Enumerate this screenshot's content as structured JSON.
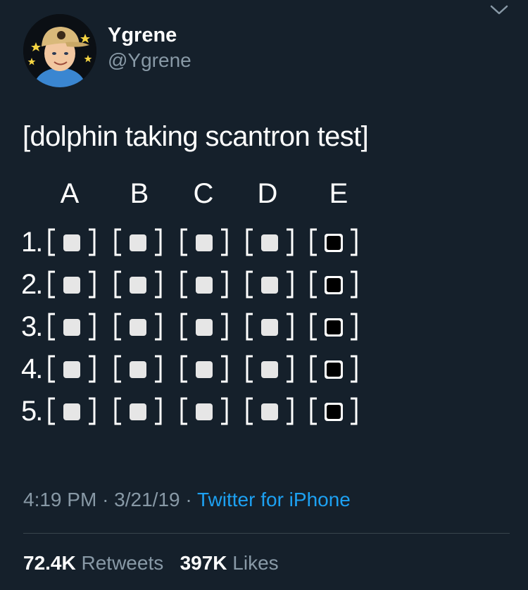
{
  "tweet": {
    "author": {
      "display_name": "Ygrene",
      "handle": "@Ygrene",
      "avatar_icon": "cartoon-avatar-cap"
    },
    "text": "[dolphin taking scantron test]",
    "answer_columns": [
      "A",
      "B",
      "C",
      "D",
      "E"
    ],
    "questions": [
      {
        "number": "1.",
        "answers": [
          "white",
          "white",
          "white",
          "white",
          "black"
        ]
      },
      {
        "number": "2.",
        "answers": [
          "white",
          "white",
          "white",
          "white",
          "black"
        ]
      },
      {
        "number": "3.",
        "answers": [
          "white",
          "white",
          "white",
          "white",
          "black"
        ]
      },
      {
        "number": "4.",
        "answers": [
          "white",
          "white",
          "white",
          "white",
          "black"
        ]
      },
      {
        "number": "5.",
        "answers": [
          "white",
          "white",
          "white",
          "white",
          "black"
        ]
      }
    ],
    "time": "4:19 PM",
    "date": "3/21/19",
    "separator": "·",
    "source": "Twitter for iPhone",
    "retweets_count": "72.4K",
    "retweets_label": "Retweets",
    "likes_count": "397K",
    "likes_label": "Likes"
  },
  "colors": {
    "background": "#15202b",
    "text": "#ffffff",
    "muted": "#8899a6",
    "link": "#1da1f2",
    "divider": "#38444d",
    "white_square": "#e6e6e6",
    "black_square": "#000000"
  },
  "icons": {
    "more": "chevron-down-icon"
  }
}
